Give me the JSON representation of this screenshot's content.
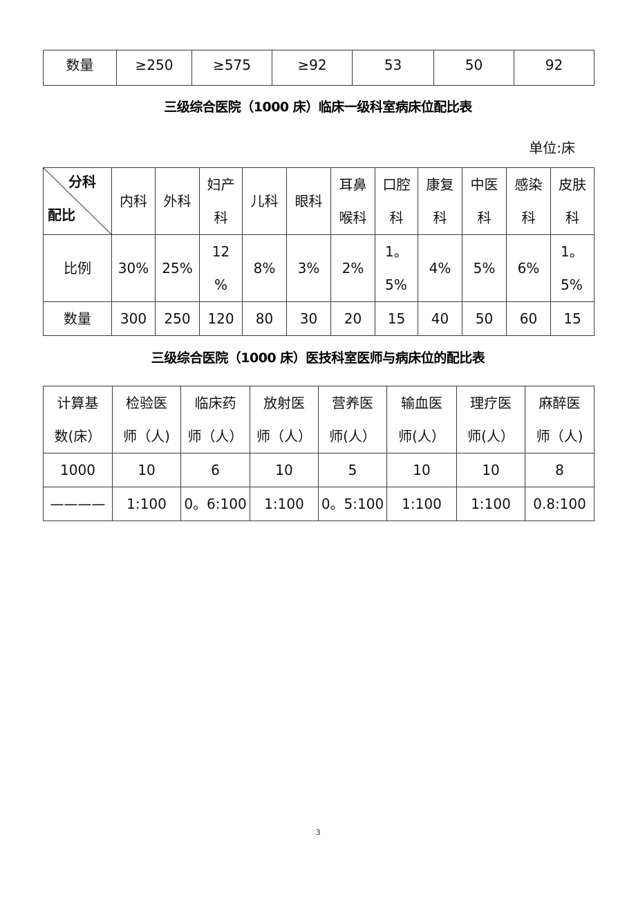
{
  "table1": {
    "row": [
      "数量",
      "≥250",
      "≥575",
      "≥92",
      "53",
      "50",
      "92"
    ]
  },
  "table2": {
    "title": "三级综合医院（1000 床）临床一级科室病床位配比表",
    "unit": "单位:床",
    "corner": {
      "top": "分科",
      "bottom": "配比"
    },
    "headers": [
      [
        "内科"
      ],
      [
        "外科"
      ],
      [
        "妇产",
        "科"
      ],
      [
        "儿科"
      ],
      [
        "眼科"
      ],
      [
        "耳鼻",
        "喉科"
      ],
      [
        "口腔",
        "科"
      ],
      [
        "康复",
        "科"
      ],
      [
        "中医",
        "科"
      ],
      [
        "感染",
        "科"
      ],
      [
        "皮肤",
        "科"
      ]
    ],
    "ratio_label": "比例",
    "ratios": [
      [
        "30%"
      ],
      [
        "25%"
      ],
      [
        "12",
        "%"
      ],
      [
        "8%"
      ],
      [
        "3%"
      ],
      [
        "2%"
      ],
      [
        "1。",
        "5%"
      ],
      [
        "4%"
      ],
      [
        "5%"
      ],
      [
        "6%"
      ],
      [
        "1。",
        "5%"
      ]
    ],
    "count_label": "数量",
    "counts": [
      "300",
      "250",
      "120",
      "80",
      "30",
      "20",
      "15",
      "40",
      "50",
      "60",
      "15"
    ]
  },
  "table3": {
    "title": "三级综合医院（1000 床）医技科室医师与病床位的配比表",
    "headers": [
      [
        "计算基",
        "数(床）"
      ],
      [
        "检验医",
        "师（人)"
      ],
      [
        "临床药",
        "师（人）"
      ],
      [
        "放射医",
        "师（人）"
      ],
      [
        "营养医",
        "师(人）"
      ],
      [
        "输血医",
        "师(人）"
      ],
      [
        "理疗医",
        "师(人）"
      ],
      [
        "麻醉医",
        "师（人)"
      ]
    ],
    "row_counts": [
      "1000",
      "10",
      "6",
      "10",
      "5",
      "10",
      "10",
      "8"
    ],
    "row_ratios": [
      "————",
      "1:100",
      "0。6:100",
      "1:100",
      "0。5:100",
      "1:100",
      "1:100",
      "0.8:100"
    ]
  },
  "page": {
    "number": "3"
  }
}
